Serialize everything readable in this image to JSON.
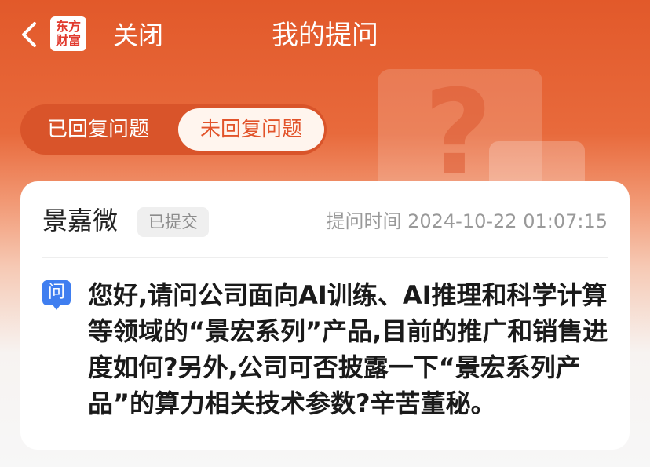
{
  "header": {
    "logo_line1": "东方",
    "logo_line2": "财富",
    "close_label": "关闭",
    "title": "我的提问"
  },
  "tabs": {
    "answered_label": "已回复问题",
    "unanswered_label": "未回复问题",
    "active": "unanswered"
  },
  "card": {
    "username": "景嘉微",
    "status": "已提交",
    "time_label": "提问时间",
    "time_value": "2024-10-22 01:07:15",
    "question_icon_label": "问",
    "question": "您好,请问公司面向AI训练、AI推理和科学计算等领域的“景宏系列”产品,目前的推广和销售进度如何?另外,公司可否披露一下“景宏系列产品”的算力相关技术参数?辛苦董秘。"
  },
  "colors": {
    "brand_orange": "#e2592a",
    "tab_active_text": "#e2532a",
    "question_icon_blue": "#3f7ef0",
    "logo_red": "#e13a2e"
  },
  "icons": {
    "back": "chevron-left-icon",
    "question_mark_decoration": "question-mark-icon"
  }
}
